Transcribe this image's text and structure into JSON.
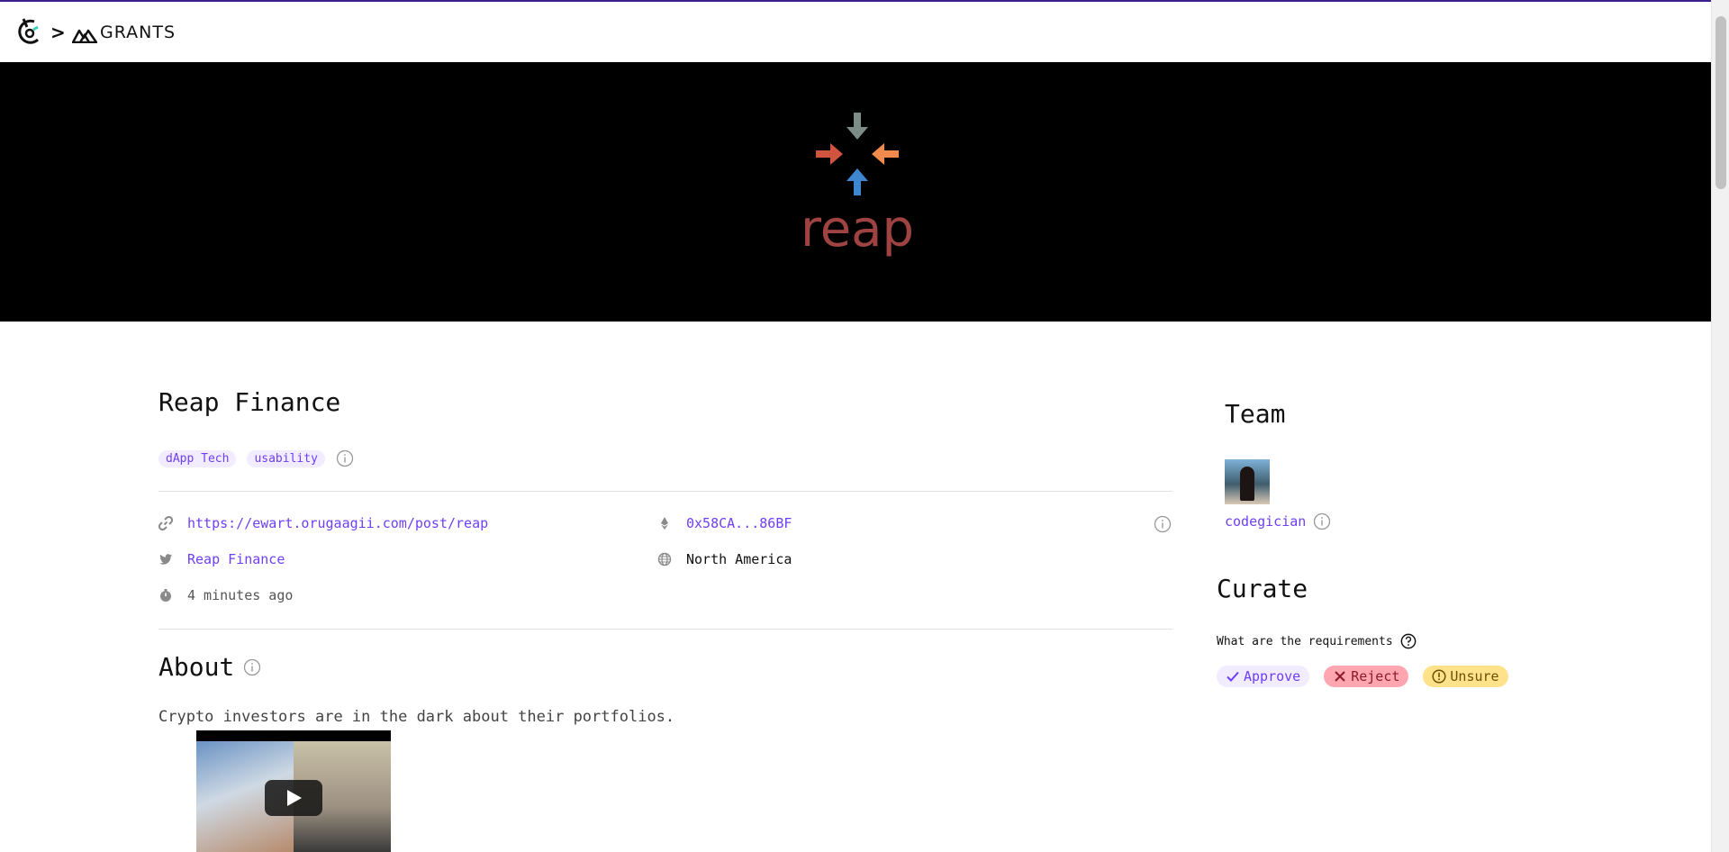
{
  "header": {
    "breadcrumb_separator": ">",
    "grants_label": "GRANTS"
  },
  "banner": {
    "logo_text": "reap"
  },
  "grant": {
    "title": "Reap Finance",
    "tags": [
      "dApp Tech",
      "usability"
    ],
    "website_url": "https://ewart.orugaagii.com/post/reap",
    "wallet_address": "0x58CA...86BF",
    "twitter_handle": "Reap Finance",
    "region": "North America",
    "created": "4 minutes ago"
  },
  "about": {
    "heading": "About",
    "text": "Crypto investors are in the dark about their portfolios."
  },
  "team": {
    "heading": "Team",
    "members": [
      {
        "username": "codegician"
      }
    ]
  },
  "curate": {
    "heading": "Curate",
    "requirements_label": "What are the requirements",
    "approve_label": "Approve",
    "reject_label": "Reject",
    "unsure_label": "Unsure"
  },
  "colors": {
    "accent": "#6f3ff5",
    "tag_bg": "#f1ecff",
    "reject_bg": "#ffa6b1",
    "unsure_bg": "#ffe28a",
    "banner_bg": "#000000",
    "logo_arrow_grey": "#7d8c86",
    "logo_arrow_red": "#d1543f",
    "logo_arrow_orange": "#f08b4d",
    "logo_arrow_blue": "#3f86d1",
    "logo_text": "#9e4242"
  }
}
